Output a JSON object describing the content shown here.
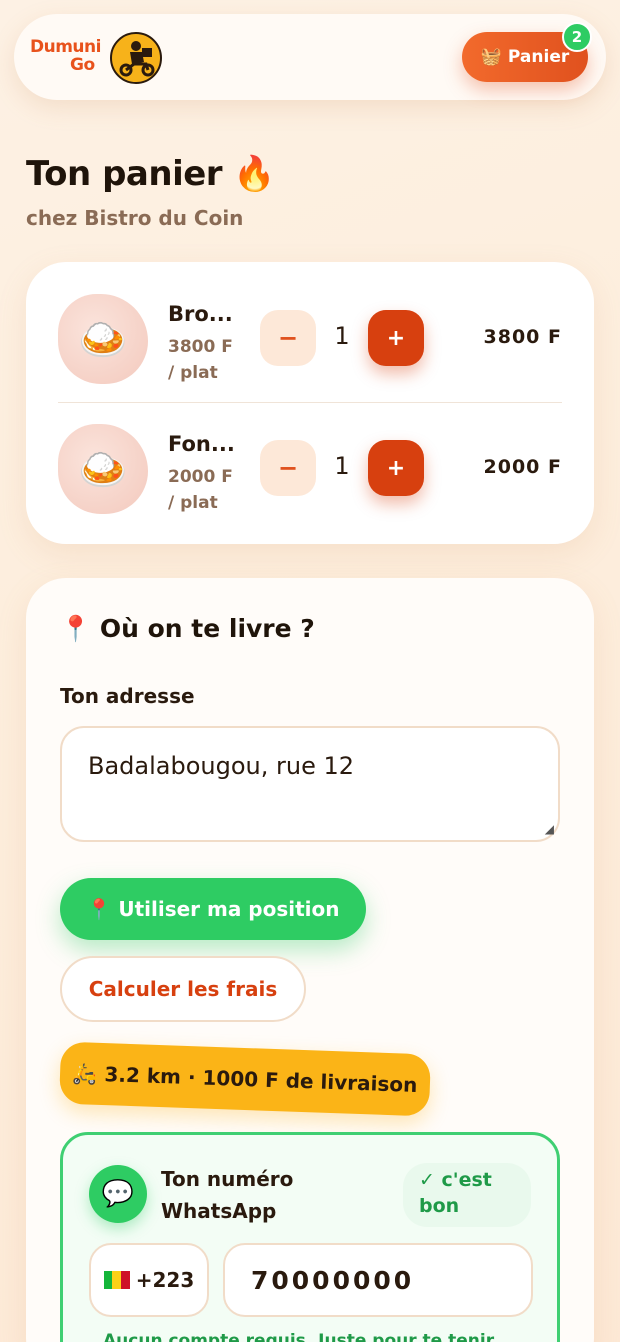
{
  "header": {
    "logo_line1": "Dumuni",
    "logo_line2": "Go",
    "cart_icon": "basket-icon",
    "cart_label": "Panier",
    "cart_count": "2"
  },
  "page": {
    "title": "Ton panier 🔥",
    "subtitle": "chez Bistro du Coin"
  },
  "cart": {
    "items": [
      {
        "name": "Bro...",
        "unit_price": "3800 F",
        "unit": "/ plat",
        "qty": "1",
        "total": "3800 F",
        "minus": "−",
        "plus": "+",
        "image_icon": "rice-dish-icon"
      },
      {
        "name": "Fon...",
        "unit_price": "2000 F",
        "unit": "/ plat",
        "qty": "1",
        "total": "2000 F",
        "minus": "−",
        "plus": "+",
        "image_icon": "rice-dish-icon"
      }
    ]
  },
  "delivery": {
    "title": "📍 Où on te livre ?",
    "address_label": "Ton adresse",
    "address_value": "Badalabougou, rue 12",
    "geo_button": "📍 Utiliser ma position",
    "calc_button": "Calculer les frais",
    "fee_text": "🛵 3.2 km · 1000 F de livraison"
  },
  "whatsapp": {
    "icon": "chat-bubble-icon",
    "label": "Ton numéro WhatsApp",
    "ok_badge": "✓ c'est bon",
    "country_code": "+223",
    "phone_value": "70000000",
    "hint": "Aucun compte requis. Juste pour te tenir"
  },
  "colors": {
    "accent": "#e0511e",
    "green": "#2ecc63",
    "yellow": "#fbb417"
  }
}
